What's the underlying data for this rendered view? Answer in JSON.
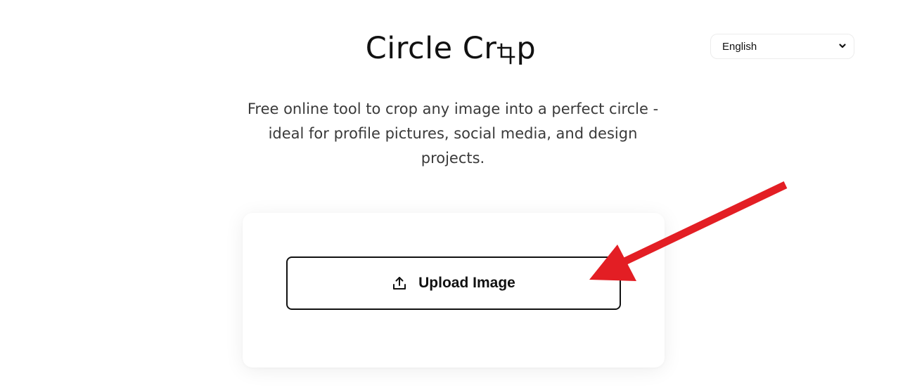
{
  "header": {
    "title_prefix": "Circle Cr",
    "title_suffix": "p",
    "title_o_icon": "crop-icon"
  },
  "language": {
    "selected": "English",
    "chevron_icon": "chevron-down-icon"
  },
  "hero": {
    "description": "Free online tool to crop any image into a perfect circle - ideal for profile pictures, social media, and design projects."
  },
  "upload": {
    "button_label": "Upload Image",
    "icon": "upload-icon"
  },
  "annotation": {
    "arrow_color": "#e31e24"
  }
}
